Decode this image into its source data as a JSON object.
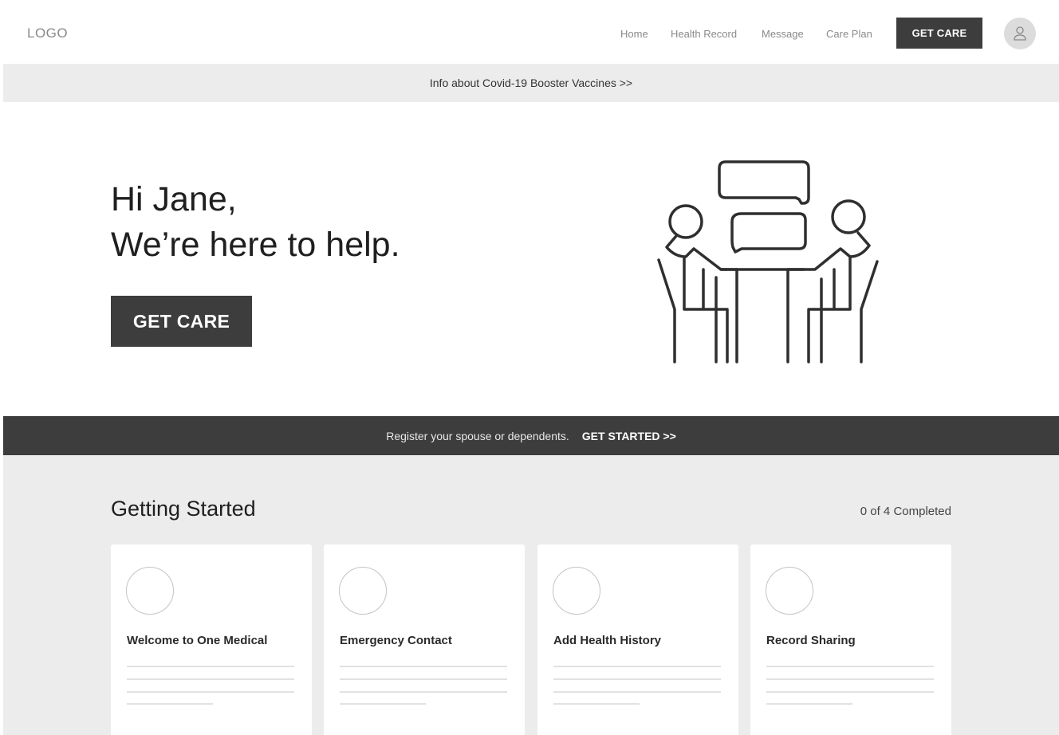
{
  "header": {
    "logo": "LOGO",
    "nav": [
      "Home",
      "Health Record",
      "Message",
      "Care Plan"
    ],
    "cta": "GET CARE"
  },
  "info_banner": "Info about Covid-19 Booster Vaccines >>",
  "hero": {
    "line1": "Hi Jane,",
    "line2": "We’re here to help.",
    "cta": "GET CARE"
  },
  "register_bar": {
    "text": "Register your spouse or dependents.",
    "link": "GET STARTED >>"
  },
  "getting_started": {
    "title": "Getting Started",
    "progress": "0 of 4 Completed",
    "cards": [
      {
        "title": "Welcome to One Medical"
      },
      {
        "title": "Emergency Contact"
      },
      {
        "title": "Add Health History"
      },
      {
        "title": "Record Sharing"
      }
    ]
  },
  "colors": {
    "dark": "#3d3d3d",
    "light_bg": "#ececec",
    "muted_text": "#8a8a8a"
  }
}
